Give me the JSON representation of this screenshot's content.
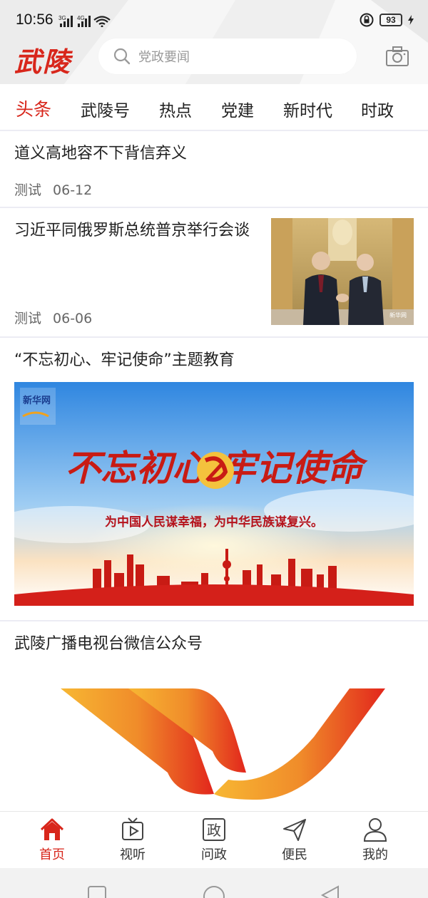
{
  "status_bar": {
    "time": "10:56",
    "network_1": "3G",
    "network_2": "4G",
    "battery": "93"
  },
  "header": {
    "logo_text": "武陵",
    "search_placeholder": "党政要闻",
    "camera_icon": "camera-icon"
  },
  "tabs": [
    {
      "label": "头条",
      "active": true
    },
    {
      "label": "武陵号",
      "active": false
    },
    {
      "label": "热点",
      "active": false
    },
    {
      "label": "党建",
      "active": false
    },
    {
      "label": "新时代",
      "active": false
    },
    {
      "label": "时政",
      "active": false
    }
  ],
  "news": [
    {
      "title": "道义高地容不下背信弃义",
      "source": "测试",
      "date": "06-12"
    },
    {
      "title": "习近平同俄罗斯总统普京举行会谈",
      "source": "测试",
      "date": "06-06",
      "thumb_watermark": "新华网"
    },
    {
      "title": "“不忘初心、牢记使命”主题教育",
      "banner_heading": "不忘初心  牢记使命",
      "banner_slogan": "为中国人民谋幸福，为中华民族谋复兴。",
      "banner_logo": "新华网"
    },
    {
      "title": "武陵广播电视台微信公众号"
    }
  ],
  "bottom_nav": [
    {
      "label": "首页",
      "icon": "home-icon",
      "active": true
    },
    {
      "label": "视听",
      "icon": "tv-icon",
      "active": false
    },
    {
      "label": "问政",
      "icon": "zheng-icon",
      "icon_text": "政",
      "active": false
    },
    {
      "label": "便民",
      "icon": "send-icon",
      "active": false
    },
    {
      "label": "我的",
      "icon": "user-icon",
      "active": false
    }
  ],
  "colors": {
    "accent": "#d8261b",
    "divider": "#ececf4",
    "text": "#222222",
    "meta": "#666666"
  }
}
